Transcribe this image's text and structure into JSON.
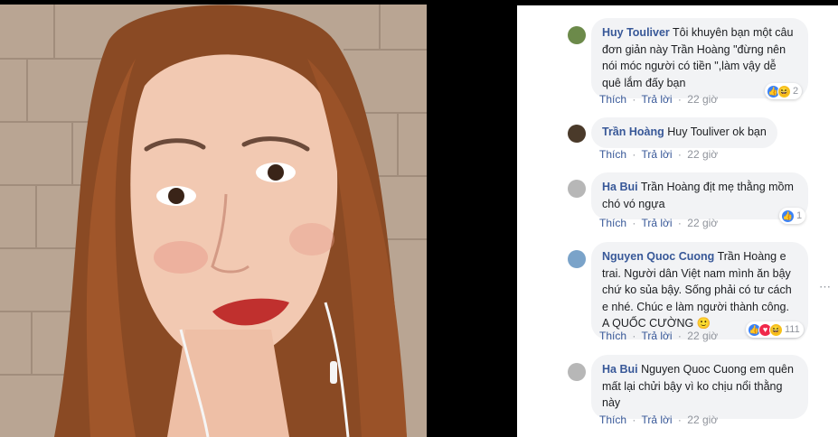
{
  "comments": [
    {
      "author": "Huy Touliver",
      "text": "Tôi khuyên bạn một câu đơn giản này Trần Hoàng \"đừng nên nói móc người có tiền \",làm vậy dễ quê lắm đấy bạn",
      "like": "Thích",
      "reply": "Trả lời",
      "time": "22 giờ",
      "reaction_count": "2"
    },
    {
      "author": "Trần Hoàng",
      "text": "Huy Touliver ok bạn",
      "like": "Thích",
      "reply": "Trả lời",
      "time": "22 giờ"
    },
    {
      "author": "Ha Bui",
      "text": "Trần Hoàng địt mẹ thằng mồm chó vó ngựa",
      "like": "Thích",
      "reply": "Trả lời",
      "time": "22 giờ",
      "reaction_count": "1"
    },
    {
      "author": "Nguyen Quoc Cuong",
      "text": "Trần Hoàng e trai. Người dân Việt nam mình ăn bậy chứ ko sủa bậy. Sống phải có tư cách e nhé. Chúc e làm người thành công. A QUỐC CƯỜNG 🙂",
      "like": "Thích",
      "reply": "Trả lời",
      "time": "22 giờ",
      "reaction_count": "111"
    },
    {
      "author": "Ha Bui",
      "text": "Nguyen Quoc Cuong em quên mất lại chửi bậy vì ko chịu nổi thằng này",
      "like": "Thích",
      "reply": "Trả lời",
      "time": "22 giờ"
    }
  ],
  "separator": "·",
  "scroll_indicator": "⋯",
  "colors": {
    "link": "#385898",
    "bubble": "#f2f3f5",
    "like": "#3b82f6",
    "love": "#f0284a",
    "haha": "#f7c21a"
  }
}
